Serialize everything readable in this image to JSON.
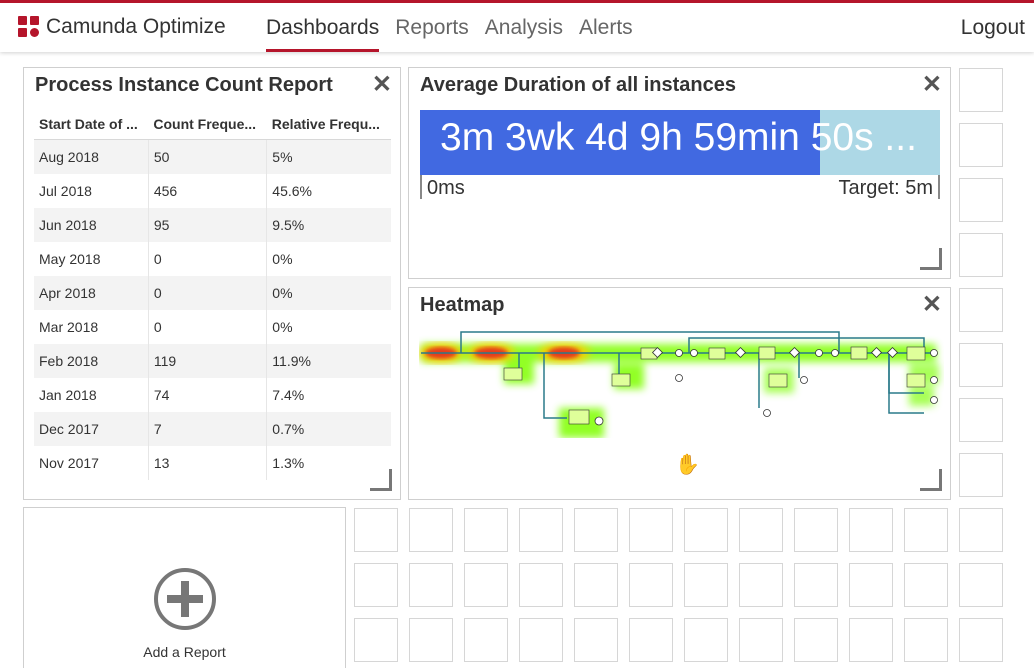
{
  "header": {
    "brand": "Camunda Optimize",
    "nav": [
      "Dashboards",
      "Reports",
      "Analysis",
      "Alerts"
    ],
    "active_nav": "Dashboards",
    "logout": "Logout",
    "accent_color": "#b5152b"
  },
  "report_tile": {
    "title": "Process Instance Count Report",
    "columns": [
      "Start Date of ...",
      "Count Freque...",
      "Relative Frequ..."
    ],
    "rows": [
      [
        "Aug 2018",
        "50",
        "5%"
      ],
      [
        "Jul 2018",
        "456",
        "45.6%"
      ],
      [
        "Jun 2018",
        "95",
        "9.5%"
      ],
      [
        "May 2018",
        "0",
        "0%"
      ],
      [
        "Apr 2018",
        "0",
        "0%"
      ],
      [
        "Mar 2018",
        "0",
        "0%"
      ],
      [
        "Feb 2018",
        "119",
        "11.9%"
      ],
      [
        "Jan 2018",
        "74",
        "7.4%"
      ],
      [
        "Dec 2017",
        "7",
        "0.7%"
      ],
      [
        "Nov 2017",
        "13",
        "1.3%"
      ]
    ],
    "close_icon": "close-icon",
    "resize_icon": "resize-handle-icon"
  },
  "duration_tile": {
    "title": "Average Duration of all instances",
    "value_label": "3m 3wk 4d 9h 59min 50s ...",
    "progress_fraction": 0.77,
    "min_label": "0ms",
    "target_label": "Target: 5m",
    "fill_color": "#4169e1",
    "track_color": "#add8e6"
  },
  "heatmap_tile": {
    "title": "Heatmap"
  },
  "add_report": {
    "label": "Add a Report",
    "icon": "plus-circle-icon"
  }
}
